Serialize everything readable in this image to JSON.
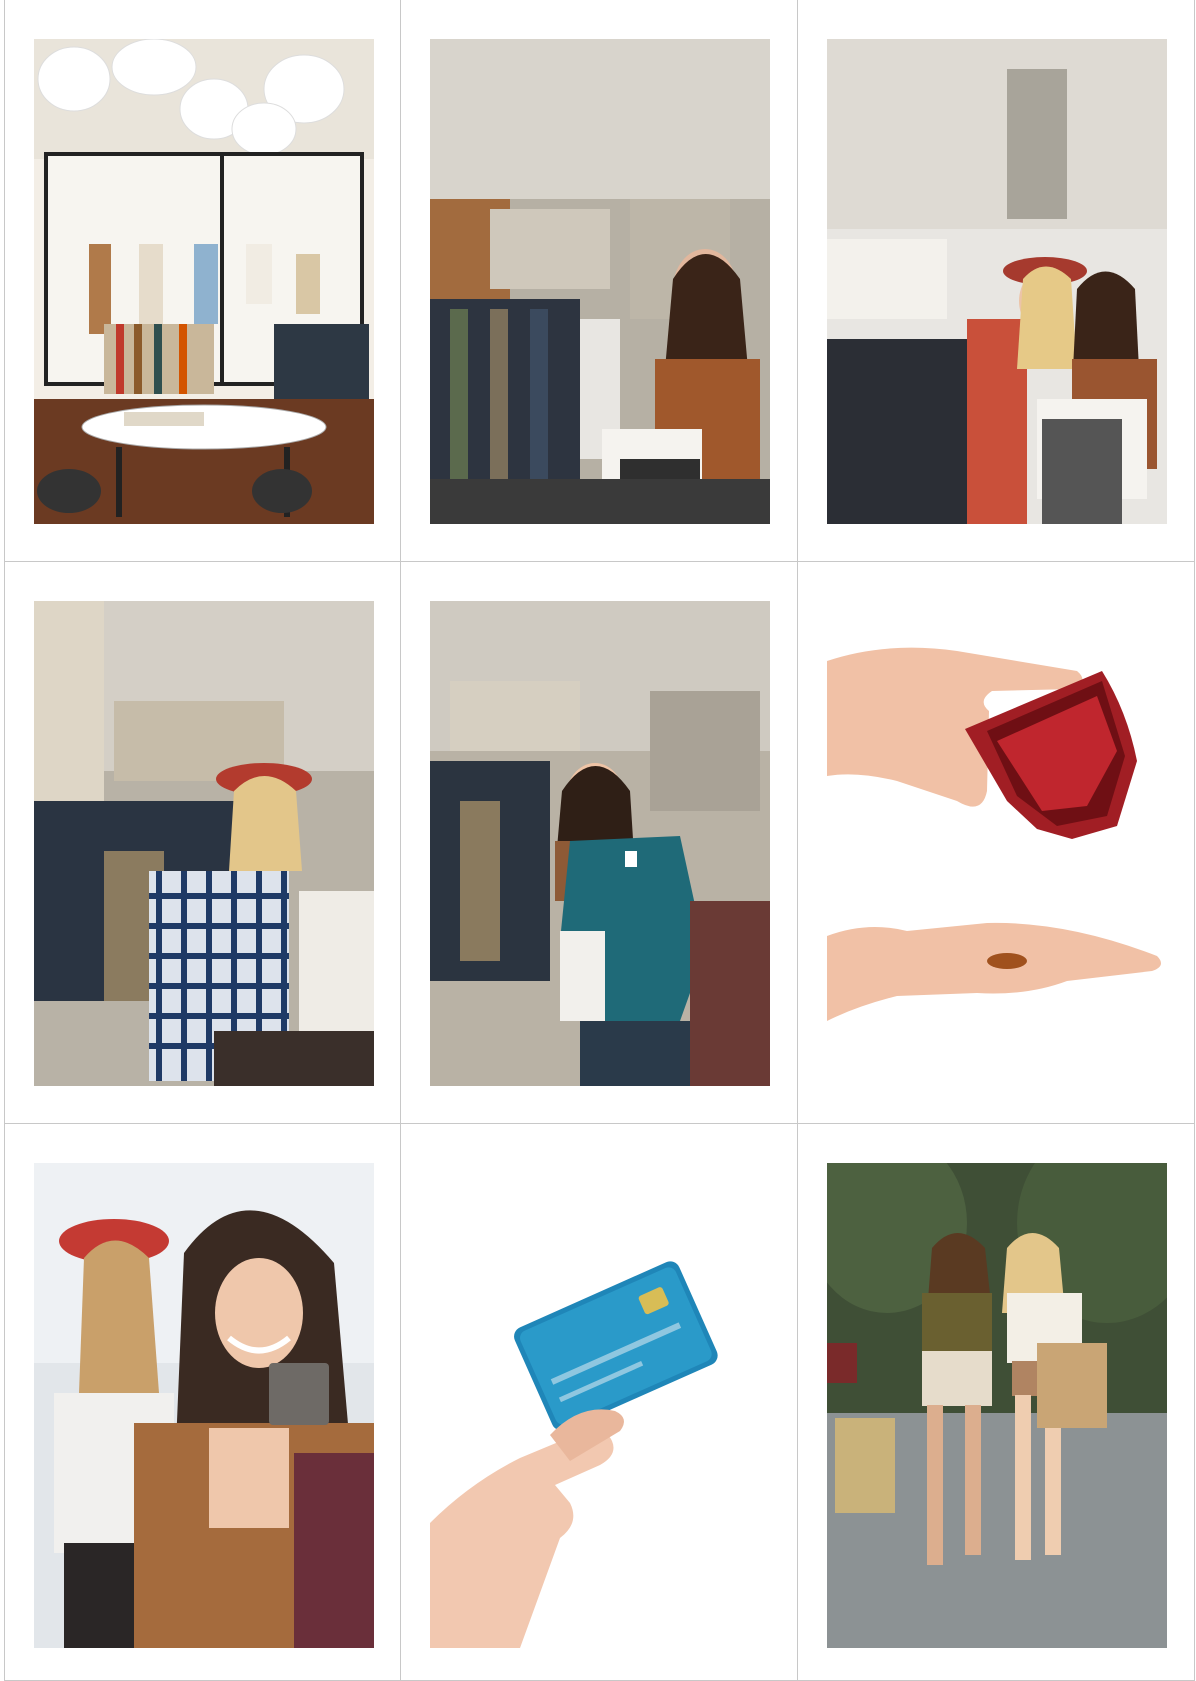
{
  "photos": [
    {
      "subject": "boutique-interior",
      "palette": {
        "light": "#f3eee6",
        "floor": "#6b3a22",
        "accent": "#c9b79a"
      }
    },
    {
      "subject": "woman-browsing-clothes",
      "palette": {
        "light": "#c9c3b8",
        "dark": "#2d3440",
        "accent": "#a0582c"
      }
    },
    {
      "subject": "two-women-holding-dress",
      "palette": {
        "light": "#e8e6e2",
        "dark": "#3a3c44",
        "accent": "#c9503a"
      }
    },
    {
      "subject": "woman-with-plaid-shirt",
      "palette": {
        "light": "#c8c2b6",
        "dark": "#2a3442",
        "accent": "#b33b2e"
      }
    },
    {
      "subject": "woman-with-teal-top",
      "palette": {
        "light": "#c6bfb2",
        "dark": "#2b3440",
        "accent": "#1f6a78"
      }
    },
    {
      "subject": "hands-wallet-coin",
      "palette": {
        "skin": "#f1c1a6",
        "wallet": "#a11e24",
        "coin": "#a0511d"
      }
    },
    {
      "subject": "women-with-card",
      "palette": {
        "light": "#e2e6ea",
        "dark": "#3a2a22",
        "accent": "#c43a33"
      }
    },
    {
      "subject": "hand-credit-card",
      "palette": {
        "skin": "#f2c8b0",
        "card": "#1f86b8",
        "chip": "#d8bd56"
      }
    },
    {
      "subject": "women-shopping-street",
      "palette": {
        "light": "#9aa6a8",
        "dark": "#3f4f36",
        "accent": "#c9a575"
      }
    }
  ]
}
